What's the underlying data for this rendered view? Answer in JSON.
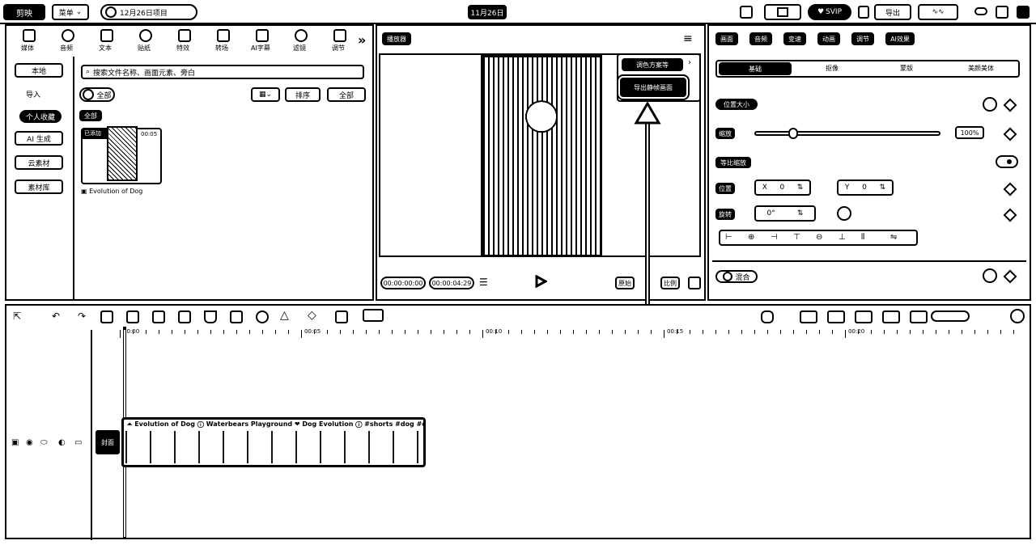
{
  "titlebar": {
    "app_name": "剪映",
    "menu_label": "菜单",
    "project_name": "12月26日项目",
    "date_label": "11月26日",
    "vip_label": "SVIP",
    "export_label": "导出"
  },
  "media_toolbar": {
    "tabs": [
      {
        "label": "媒体",
        "icon": "media-icon"
      },
      {
        "label": "音频",
        "icon": "audio-icon"
      },
      {
        "label": "文本",
        "icon": "text-icon"
      },
      {
        "label": "贴纸",
        "icon": "sticker-icon"
      },
      {
        "label": "特效",
        "icon": "effects-icon"
      },
      {
        "label": "转场",
        "icon": "transition-icon"
      },
      {
        "label": "AI字幕",
        "icon": "caption-icon"
      },
      {
        "label": "滤镜",
        "icon": "filter-icon"
      },
      {
        "label": "调节",
        "icon": "adjust-icon"
      }
    ]
  },
  "media_sidebar": {
    "items": [
      "本地",
      "导入",
      "个人收藏",
      "AI 生成",
      "云素材",
      "素材库"
    ]
  },
  "media_panel": {
    "search_placeholder": "搜索文件名称、画面元素、旁白",
    "filter_label": "全部",
    "view_label": "排序",
    "sort_label": "全部",
    "all_tag": "全部",
    "clip_added": "已添加",
    "clip_duration": "00:05",
    "clip_name": "Evolution of Dog"
  },
  "player": {
    "title": "播放器",
    "current_time": "00:00:00:00",
    "total_time": "00:00:04:29",
    "ratio_label": "原始",
    "quality_label": "比例",
    "menu_item_1": "调色方案等",
    "menu_item_2": "导出静帧画面"
  },
  "inspector": {
    "tabs": [
      "画面",
      "音频",
      "变速",
      "动画",
      "调节",
      "AI效果"
    ],
    "subtabs": [
      "基础",
      "抠像",
      "蒙版",
      "美颜美体"
    ],
    "section_basic": "位置大小",
    "scale_label": "缩放",
    "scale_value": "100%",
    "uniform_label": "等比缩放",
    "position_label": "位置",
    "pos_x": "0",
    "pos_y": "0",
    "rotate_label": "旋转",
    "rotate_value": "0°",
    "blend_label": "混合"
  },
  "timeline": {
    "ruler_labels": [
      "00:00",
      "00:05",
      "00:10",
      "00:15",
      "00:20"
    ],
    "track_label": "封面",
    "clip_title": "Evolution of Dog ⓘ Waterbears Playground ❤ Dog Evolution ⓘ #shorts #dog #cute #"
  }
}
